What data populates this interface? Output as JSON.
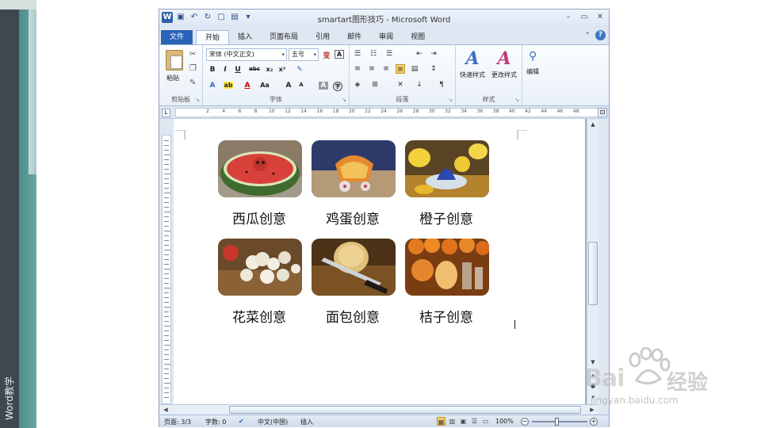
{
  "sidebar": {
    "label": "Word教学"
  },
  "window": {
    "title": "smartart图形技巧 - Microsoft Word",
    "qat_icons": [
      "word-logo-icon",
      "save-icon",
      "undo-icon",
      "redo-icon",
      "new-doc-icon",
      "print-preview-icon",
      "customize-icon"
    ]
  },
  "tabs": [
    "文件",
    "开始",
    "插入",
    "页面布局",
    "引用",
    "邮件",
    "审阅",
    "视图"
  ],
  "active_tab": "开始",
  "ribbon": {
    "clipboard": {
      "paste": "粘贴",
      "label": "剪贴板"
    },
    "font": {
      "name": "宋体 (中文正文)",
      "size": "五号",
      "label": "字体"
    },
    "paragraph": {
      "label": "段落"
    },
    "styles": {
      "quick": "快速样式",
      "change": "更改样式",
      "label": "样式"
    },
    "editing": {
      "label": "编辑"
    }
  },
  "ruler": {
    "ticks": [
      "2",
      "4",
      "6",
      "8",
      "10",
      "12",
      "14",
      "16",
      "18",
      "20",
      "22",
      "24",
      "26",
      "28",
      "30",
      "32",
      "34",
      "36",
      "38",
      "40",
      "42",
      "44",
      "46",
      "48"
    ]
  },
  "smartart": {
    "items": [
      {
        "caption": "西瓜创意",
        "icon": "watermelon-image"
      },
      {
        "caption": "鸡蛋创意",
        "icon": "egg-cart-image"
      },
      {
        "caption": "橙子创意",
        "icon": "orange-juicer-image"
      },
      {
        "caption": "花菜创意",
        "icon": "cauliflower-image"
      },
      {
        "caption": "面包创意",
        "icon": "bread-image"
      },
      {
        "caption": "桔子创意",
        "icon": "tangerine-image"
      }
    ]
  },
  "status": {
    "page": "页面: 3/3",
    "words": "字数: 0",
    "language": "中文(中国)",
    "mode": "插入",
    "zoom": "100%"
  },
  "watermark": {
    "brand": "Bai",
    "brand2": "经验",
    "url": "jingyan.baidu.com"
  }
}
